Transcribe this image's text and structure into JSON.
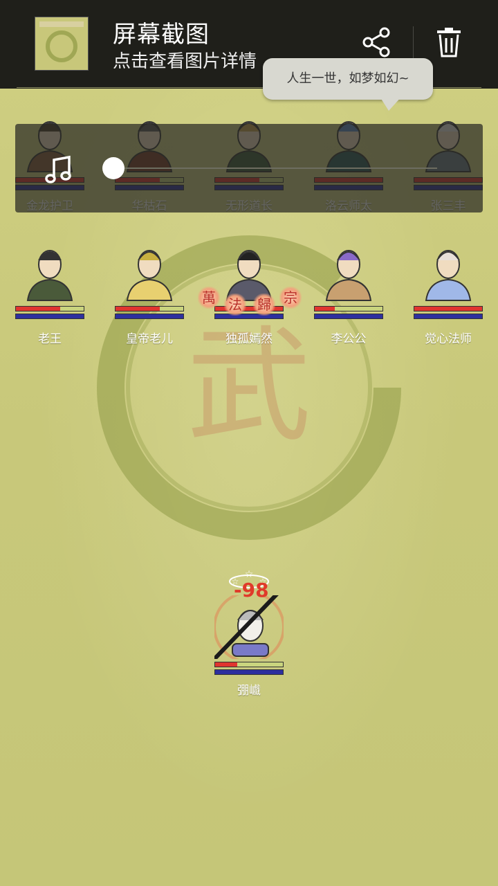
{
  "notification": {
    "title": "屏幕截图",
    "subtitle": "点击查看图片详情",
    "share_icon": "share-icon",
    "delete_icon": "trash-icon"
  },
  "speech_bubble": "人生一世，如梦如幻~",
  "music_overlay": {
    "icon": "music-note-icon",
    "progress": 0.0
  },
  "enemies": [
    {
      "name": "金龙护卫",
      "hp": 1.0,
      "mp": 1.0
    },
    {
      "name": "华枯石",
      "hp": 0.65,
      "mp": 1.0
    },
    {
      "name": "无形道长",
      "hp": 0.65,
      "mp": 1.0
    },
    {
      "name": "洛云师太",
      "hp": 1.0,
      "mp": 1.0
    },
    {
      "name": "张三丰",
      "hp": 1.0,
      "mp": 1.0
    }
  ],
  "allies": [
    {
      "name": "老王",
      "hp": 0.65,
      "mp": 1.0
    },
    {
      "name": "皇帝老儿",
      "hp": 0.65,
      "mp": 1.0
    },
    {
      "name": "独孤嫣然",
      "hp": 1.0,
      "mp": 1.0
    },
    {
      "name": "李公公",
      "hp": 0.3,
      "mp": 1.0
    },
    {
      "name": "觉心法师",
      "hp": 1.0,
      "mp": 1.0
    }
  ],
  "skill_name": [
    "萬",
    "法",
    "歸",
    "宗"
  ],
  "player": {
    "name": "弸巇",
    "hp": 0.33,
    "mp": 1.0,
    "damage": "-98"
  },
  "colors": {
    "hp": "#e0342f",
    "mp": "#2d2f9e",
    "background": "#c9c97b",
    "notif_bg": "#1f1f1a"
  }
}
